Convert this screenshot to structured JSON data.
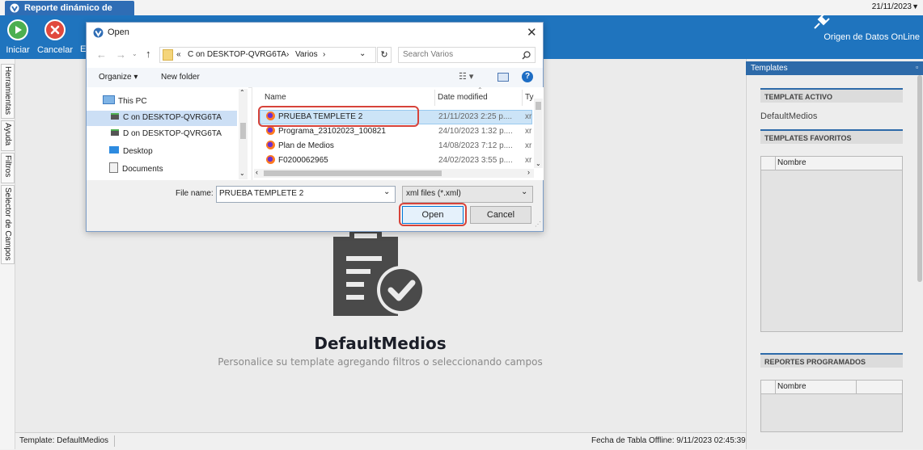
{
  "app": {
    "tab_title": "Reporte dinámico de medios",
    "top_date": "21/11/2023",
    "toolbar": {
      "start_label": "Iniciar",
      "cancel_label": "Cancelar",
      "third_label": "E",
      "origin_label": "Origen de Datos OnLine"
    }
  },
  "left_tabs": [
    "Herramientas",
    "Ayuda",
    "Filtros",
    "Selector de Campos"
  ],
  "main": {
    "template_name": "DefaultMedios",
    "hint": "Personalice su template agregando filtros o seleccionando campos"
  },
  "right_panel": {
    "title": "Templates",
    "active_header": "TEMPLATE ACTIVO",
    "active_value": "DefaultMedios",
    "favorites_header": "TEMPLATES FAVORITOS",
    "favorites_col": "Nombre",
    "scheduled_header": "REPORTES PROGRAMADOS",
    "scheduled_col": "Nombre"
  },
  "status": {
    "template": "Template: DefaultMedios",
    "offline_date": "Fecha de Tabla Offline: 9/11/2023 02:45:39"
  },
  "dialog": {
    "title": "Open",
    "path": [
      "«",
      "C on DESKTOP-QVRG6TA",
      "›",
      "Varios",
      "›"
    ],
    "search_placeholder": "Search Varios",
    "organize_label": "Organize ▾",
    "new_folder_label": "New folder",
    "nav_items": [
      "This PC",
      "C on DESKTOP-QVRG6TA",
      "D on DESKTOP-QVRG6TA",
      "Desktop",
      "Documents"
    ],
    "columns": {
      "name": "Name",
      "date": "Date modified",
      "type": "Ty"
    },
    "files": [
      {
        "name": "PRUEBA TEMPLETE 2",
        "date": "21/11/2023 2:25 p....",
        "type": "xr"
      },
      {
        "name": "Programa_23102023_100821",
        "date": "24/10/2023 1:32 p....",
        "type": "xr"
      },
      {
        "name": "Plan de Medios",
        "date": "14/08/2023 7:12 p....",
        "type": "xr"
      },
      {
        "name": "F0200062965",
        "date": "24/02/2023 3:55 p....",
        "type": "xr"
      }
    ],
    "file_name_label": "File name:",
    "file_name_value": "PRUEBA TEMPLETE 2",
    "file_type": "xml files (*.xml)",
    "open_label": "Open",
    "cancel_label": "Cancel"
  }
}
